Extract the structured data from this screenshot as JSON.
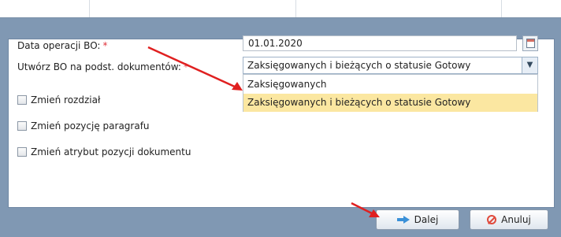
{
  "form": {
    "date_label": "Data operacji BO:",
    "date_value": "01.01.2020",
    "source_label": "Utwórz BO na podst. dokumentów:",
    "required_mark": "*",
    "select_value": "Zaksięgowanych i bieżących o statusie Gotowy",
    "select_arrow": "▼",
    "options": [
      "Zaksięgowanych",
      "Zaksięgowanych i bieżących o statusie Gotowy"
    ],
    "checkboxes": [
      "Zmień rozdział",
      "Zmień pozycję paragrafu",
      "Zmień atrybut pozycji dokumentu"
    ]
  },
  "buttons": {
    "next_label": "Dalej",
    "cancel_label": "Anuluj"
  },
  "icons": {
    "calendar": "calendar-icon",
    "next": "arrow-right-icon",
    "cancel": "cancel-icon"
  },
  "colors": {
    "dialog_frame": "#8098b3",
    "selected_option": "#fbe7a1",
    "required": "#e0323a",
    "annotation_arrow": "#e02020"
  }
}
